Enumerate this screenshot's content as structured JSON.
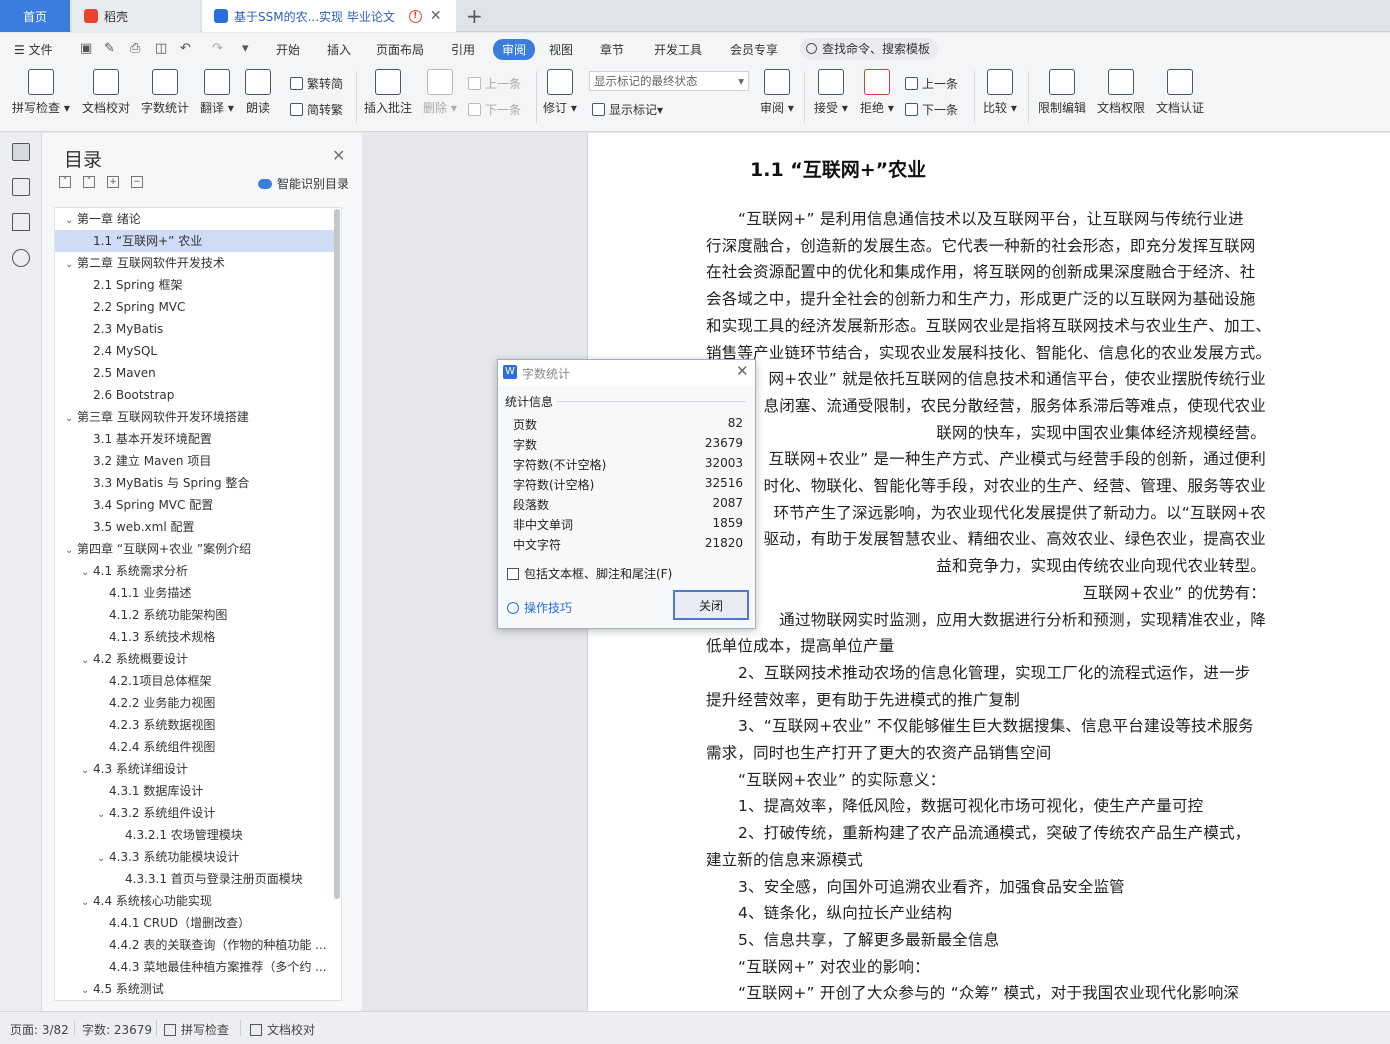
{
  "tabs": {
    "home": "首页",
    "daoke": "稻壳",
    "document": "基于SSM的农...实现 毕业论文"
  },
  "menu": {
    "file": "文件",
    "items": [
      "开始",
      "插入",
      "页面布局",
      "引用",
      "审阅",
      "视图",
      "章节",
      "开发工具",
      "会员专享"
    ],
    "active_index": 4,
    "search_placeholder": "查找命令、搜索模板"
  },
  "ribbon": {
    "spell_check": "拼写检查",
    "doc_proof": "文档校对",
    "word_count": "字数统计",
    "translate": "翻译",
    "read_aloud": "朗读",
    "trad_to_simp": "繁转简",
    "simp_to_trad": "简转繁",
    "insert_comment": "插入批注",
    "delete": "删除",
    "prev_comment": "上一条",
    "next_comment": "下一条",
    "track_changes": "修订",
    "markup_mode": "显示标记的最终状态",
    "show_markup": "显示标记",
    "review": "审阅",
    "accept": "接受",
    "reject": "拒绝",
    "prev_change": "上一条",
    "next_change": "下一条",
    "compare": "比较",
    "restrict_edit": "限制编辑",
    "doc_permission": "文档权限",
    "doc_cert": "文档认证"
  },
  "toc": {
    "title": "目录",
    "smart_label": "智能识别目录",
    "items": [
      {
        "label": "第一章  绪论",
        "level": 1,
        "expanded": true
      },
      {
        "label": "1.1   “互联网+” 农业",
        "level": 2,
        "selected": true
      },
      {
        "label": "第二章  互联网软件开发技术",
        "level": 1,
        "expanded": true
      },
      {
        "label": "2.1 Spring 框架",
        "level": 2
      },
      {
        "label": "2.2 Spring MVC",
        "level": 2
      },
      {
        "label": "2.3 MyBatis",
        "level": 2
      },
      {
        "label": "2.4 MySQL",
        "level": 2
      },
      {
        "label": "2.5 Maven",
        "level": 2
      },
      {
        "label": "2.6 Bootstrap",
        "level": 2
      },
      {
        "label": "第三章   互联网软件开发环境搭建",
        "level": 1,
        "expanded": true
      },
      {
        "label": "3.1  基本开发环境配置",
        "level": 2
      },
      {
        "label": "3.2  建立 Maven 项目",
        "level": 2
      },
      {
        "label": "3.3 MyBatis 与 Spring 整合",
        "level": 2
      },
      {
        "label": "3.4   Spring MVC 配置",
        "level": 2
      },
      {
        "label": "3.5 web.xml 配置",
        "level": 2
      },
      {
        "label": "第四章   “互联网+农业 ”案例介绍",
        "level": 1,
        "expanded": true
      },
      {
        "label": "4.1  系统需求分析",
        "level": 2,
        "expanded": true
      },
      {
        "label": "4.1.1  业务描述",
        "level": 3
      },
      {
        "label": "4.1.2  系统功能架构图",
        "level": 3
      },
      {
        "label": "4.1.3  系统技术规格",
        "level": 3
      },
      {
        "label": "4.2  系统概要设计",
        "level": 2,
        "expanded": true
      },
      {
        "label": "4.2.1项目总体框架",
        "level": 3
      },
      {
        "label": "4.2.2  业务能力视图",
        "level": 3
      },
      {
        "label": "4.2.3  系统数据视图",
        "level": 3
      },
      {
        "label": "4.2.4  系统组件视图",
        "level": 3
      },
      {
        "label": "4.3  系统详细设计",
        "level": 2,
        "expanded": true
      },
      {
        "label": "4.3.1  数据库设计",
        "level": 3
      },
      {
        "label": "4.3.2  系统组件设计",
        "level": 3,
        "expanded": true
      },
      {
        "label": "4.3.2.1 农场管理模块",
        "level": 4
      },
      {
        "label": "4.3.3  系统功能模块设计",
        "level": 3,
        "expanded": true
      },
      {
        "label": "4.3.3.1 首页与登录注册页面模块",
        "level": 4
      },
      {
        "label": "4.4  系统核心功能实现",
        "level": 2,
        "expanded": true
      },
      {
        "label": "4.4.1 CRUD（增删改查）",
        "level": 3
      },
      {
        "label": "4.4.2 表的关联查询（作物的种植功能 ...",
        "level": 3
      },
      {
        "label": "4.4.3 菜地最佳种植方案推荐（多个约 ...",
        "level": 3
      },
      {
        "label": "4.5  系统测试",
        "level": 2,
        "expanded": true
      }
    ]
  },
  "document": {
    "heading": "1.1  “互联网+”农业",
    "lines": [
      {
        "text": "“互联网+” 是利用信息通信技术以及互联网平台，让互联网与传统行业进",
        "indent": true
      },
      {
        "text": "行深度融合，创造新的发展生态。它代表一种新的社会形态，即充分发挥互联网",
        "indent": false
      },
      {
        "text": "在社会资源配置中的优化和集成作用，将互联网的创新成果深度融合于经济、社",
        "indent": false
      },
      {
        "text": "会各域之中，提升全社会的创新力和生产力，形成更广泛的以互联网为基础设施",
        "indent": false
      },
      {
        "text": "和实现工具的经济发展新形态。互联网农业是指将互联网技术与农业生产、加工、",
        "indent": false
      },
      {
        "text": "销售等产业链环节结合，实现农业发展科技化、智能化、信息化的农业发展方式。",
        "indent": false
      },
      {
        "text": "网+农业” 就是依托互联网的信息技术和通信平台，使农业摆脱传统行业",
        "indent": false,
        "hidden_start": true
      },
      {
        "text": "息闭塞、流通受限制，农民分散经营，服务体系滞后等难点，使现代农业",
        "indent": false,
        "hidden_start": true
      },
      {
        "text": "联网的快车，实现中国农业集体经济规模经营。",
        "indent": false,
        "hidden_start": true
      },
      {
        "text": "互联网+农业” 是一种生产方式、产业模式与经营手段的创新，通过便利",
        "indent": false,
        "hidden_start": true
      },
      {
        "text": "时化、物联化、智能化等手段，对农业的生产、经营、管理、服务等农业",
        "indent": false,
        "hidden_start": true
      },
      {
        "text": "环节产生了深远影响，为农业现代化发展提供了新动力。以“互联网+农",
        "indent": false,
        "hidden_start": true
      },
      {
        "text": "驱动，有助于发展智慧农业、精细农业、高效农业、绿色农业，提高农业",
        "indent": false,
        "hidden_start": true
      },
      {
        "text": "益和竞争力，实现由传统农业向现代农业转型。",
        "indent": false,
        "hidden_start": true
      },
      {
        "text": "互联网+农业” 的优势有：",
        "indent": false,
        "hidden_start": true
      },
      {
        "text": "通过物联网实时监测，应用大数据进行分析和预测，实现精准农业，降",
        "indent": false,
        "hidden_start": true
      },
      {
        "text": "低单位成本，提高单位产量",
        "indent": false
      },
      {
        "text": "2、互联网技术推动农场的信息化管理，实现工厂化的流程式运作，进一步",
        "indent": true
      },
      {
        "text": "提升经营效率，更有助于先进模式的推广复制",
        "indent": false
      },
      {
        "text": "3、“互联网+农业” 不仅能够催生巨大数据搜集、信息平台建设等技术服务",
        "indent": true
      },
      {
        "text": "需求，同时也生产打开了更大的农资产品销售空间",
        "indent": false
      },
      {
        "text": "“互联网+农业” 的实际意义：",
        "indent": true
      },
      {
        "text": "1、提高效率，降低风险，数据可视化市场可视化，使生产产量可控",
        "indent": true
      },
      {
        "text": "2、打破传统，重新构建了农产品流通模式，突破了传统农产品生产模式，",
        "indent": true
      },
      {
        "text": "建立新的信息来源模式",
        "indent": false
      },
      {
        "text": "3、安全感，向国外可追溯农业看齐，加强食品安全监管",
        "indent": true
      },
      {
        "text": "4、链条化，纵向拉长产业结构",
        "indent": true
      },
      {
        "text": "5、信息共享，了解更多最新最全信息",
        "indent": true
      },
      {
        "text": "“互联网+” 对农业的影响：",
        "indent": true
      },
      {
        "text": "“互联网+” 开创了大众参与的 “众筹” 模式，对于我国农业现代化影响深",
        "indent": true
      }
    ]
  },
  "dialog": {
    "logo": "W",
    "title": "字数统计",
    "section": "统计信息",
    "stats": [
      {
        "label": "页数",
        "value": "82"
      },
      {
        "label": "字数",
        "value": "23679"
      },
      {
        "label": "字符数(不计空格)",
        "value": "32003"
      },
      {
        "label": "字符数(计空格)",
        "value": "32516"
      },
      {
        "label": "段落数",
        "value": "2087"
      },
      {
        "label": "非中文单词",
        "value": "1859"
      },
      {
        "label": "中文字符",
        "value": "21820"
      }
    ],
    "checkbox_label": "包括文本框、脚注和尾注(F)",
    "tips_label": "操作技巧",
    "close_button": "关闭"
  },
  "statusbar": {
    "page": "页面: 3/82",
    "words": "字数: 23679",
    "spell": "拼写检查",
    "proof": "文档校对"
  }
}
